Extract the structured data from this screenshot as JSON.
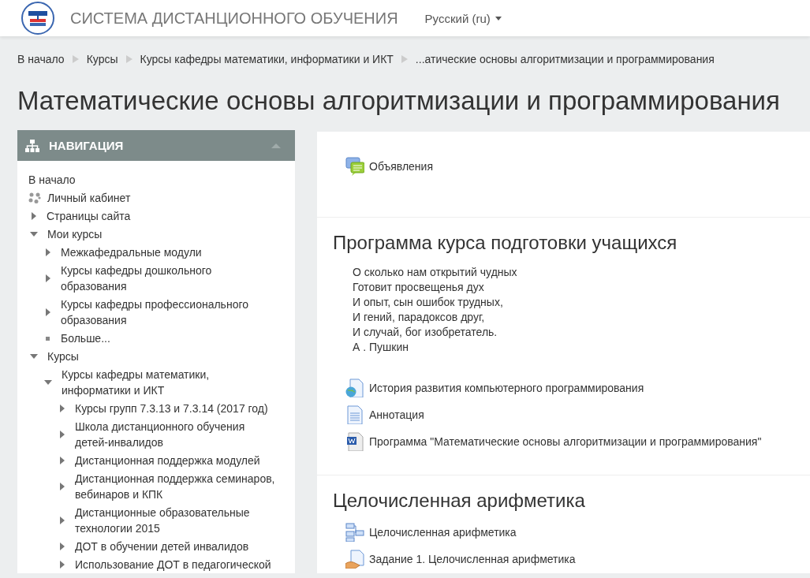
{
  "header": {
    "site_title": "СИСТЕМА ДИСТАНЦИОННОГО ОБУЧЕНИЯ",
    "language": "Русский (ru)"
  },
  "breadcrumb": [
    "В начало",
    "Курсы",
    "Курсы кафедры математики, информатики и ИКТ",
    "...атические основы алгоритмизации и программирования"
  ],
  "page_title": "Математические основы алгоритмизации и программирования",
  "navigation": {
    "title": "НАВИГАЦИЯ",
    "expanded": true,
    "items": [
      {
        "label": "В начало",
        "kind": "plain"
      },
      {
        "label": "Личный кабинет",
        "kind": "dashboard"
      },
      {
        "label": "Страницы сайта",
        "kind": "branch",
        "expanded": false
      },
      {
        "label": "Мои курсы",
        "kind": "branch",
        "expanded": true,
        "children": [
          {
            "label": "Межкафедральные модули",
            "kind": "branch",
            "expanded": false
          },
          {
            "label": "Курсы кафедры дошкольного образования",
            "kind": "branch",
            "expanded": false
          },
          {
            "label": "Курсы кафедры профессионального образования",
            "kind": "branch",
            "expanded": false
          },
          {
            "label": "Больше...",
            "kind": "more"
          }
        ]
      },
      {
        "label": "Курсы",
        "kind": "branch",
        "expanded": true,
        "children": [
          {
            "label": "Курсы кафедры математики, информатики и ИКТ",
            "kind": "branch",
            "expanded": true,
            "children": [
              {
                "label": "Курсы групп 7.3.13 и 7.3.14 (2017 год)",
                "kind": "branch",
                "expanded": false
              },
              {
                "label": "Школа дистанционного обучения детей-инвалидов",
                "kind": "branch",
                "expanded": false
              },
              {
                "label": "Дистанционная поддержка модулей",
                "kind": "branch",
                "expanded": false
              },
              {
                "label": "Дистанционная поддержка семинаров, вебинаров и КПК",
                "kind": "branch",
                "expanded": false
              },
              {
                "label": "Дистанционные образовательные технологии 2015",
                "kind": "branch",
                "expanded": false
              },
              {
                "label": "ДОТ в обучении детей инвалидов",
                "kind": "branch",
                "expanded": false
              },
              {
                "label": "Использование ДОТ в педагогической",
                "kind": "branch",
                "expanded": false
              }
            ]
          }
        ]
      }
    ]
  },
  "sections": [
    {
      "activities": [
        {
          "kind": "forum",
          "label": "Объявления"
        }
      ]
    },
    {
      "title": "Программа курса подготовки учащихся",
      "summary": [
        "О сколько нам открытий чудных",
        "Готовит просвещенья дух",
        "И опыт, сын ошибок трудных,",
        "И гений, парадоксов друг,",
        "И случай, бог изобретатель.",
        "А . Пушкин"
      ],
      "activities": [
        {
          "kind": "url",
          "label": "История развития компьютерного программирования"
        },
        {
          "kind": "page",
          "label": "Аннотация"
        },
        {
          "kind": "word",
          "label": "Программа \"Математические основы алгоритмизации и программирования\""
        }
      ]
    },
    {
      "title": "Целочисленная арифметика",
      "activities": [
        {
          "kind": "book",
          "label": "Целочисленная арифметика"
        },
        {
          "kind": "assign",
          "label": "Задание 1. Целочисленная арифметика"
        }
      ]
    }
  ]
}
